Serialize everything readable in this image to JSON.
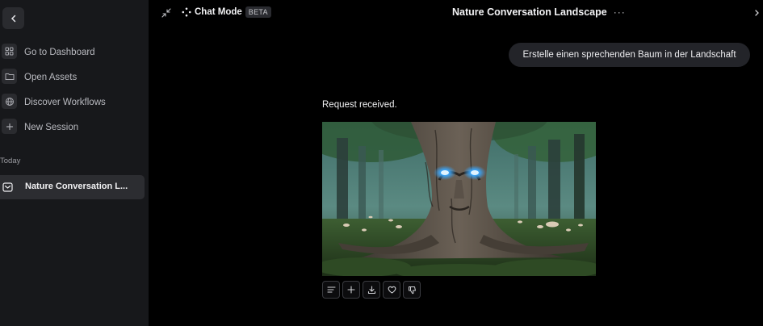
{
  "sidebar": {
    "collapse_icon": "chevron-left-icon",
    "nav": [
      {
        "label": "Go to Dashboard",
        "icon": "grid-icon"
      },
      {
        "label": "Open Assets",
        "icon": "folder-icon"
      },
      {
        "label": "Discover Workflows",
        "icon": "globe-icon"
      },
      {
        "label": "New Session",
        "icon": "plus-icon"
      }
    ],
    "section_label": "Today",
    "sessions": [
      {
        "label": "Nature Conversation L...",
        "icon": "chat-icon"
      }
    ]
  },
  "header": {
    "shrink_icon": "minimize-icon",
    "mode_label": "Chat Mode",
    "mode_badge": "BETA",
    "title": "Nature Conversation Landscape",
    "more_label": "···"
  },
  "chat": {
    "user_message": "Erstelle einen sprechenden Baum in der Landschaft",
    "assistant_text": "Request received.",
    "image": "talking tree with glowing blue eyes in misty forest",
    "actions": [
      "text-icon",
      "plus-icon",
      "download-icon",
      "heart-icon",
      "thumbs-down-icon"
    ]
  },
  "colors": {
    "background": "#000000",
    "sidebar": "#17181b",
    "active_item": "#2c2d31",
    "user_bubble": "#232429",
    "eye_glow": "#3aa8ff"
  }
}
